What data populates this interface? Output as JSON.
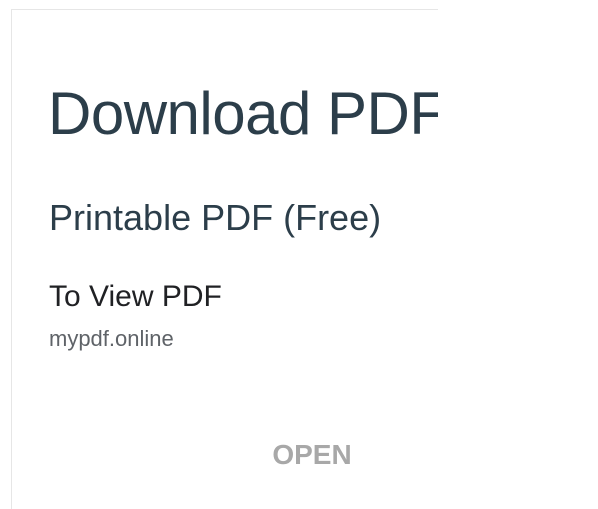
{
  "ad": {
    "headline": "Download PDF",
    "subhead": "Printable PDF (Free)",
    "description": "To View PDF",
    "domain": "mypdf.online",
    "cta_label": "OPEN"
  },
  "colors": {
    "headline": "#2c3e4a",
    "description": "#202124",
    "domain": "#5f6368",
    "cta": "#a8a8a8",
    "border": "#e6e6e6"
  }
}
